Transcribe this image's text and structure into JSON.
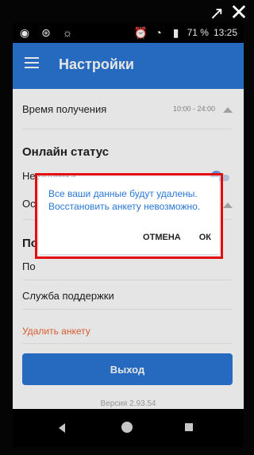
{
  "statusbar": {
    "battery_text": "71 %",
    "time": "13:25"
  },
  "appbar": {
    "title": "Настройки"
  },
  "settings": {
    "receive_time_label": "Время получения",
    "receive_time_value": "10:00 - 24:00",
    "online_status_heading": "Онлайн статус",
    "invisible_label": "Невидимка",
    "partial_1": "Ос",
    "partial_2": "По",
    "partial_3": "По",
    "support_label": "Служба поддержки",
    "delete_profile_label": "Удалить анкету",
    "logout_label": "Выход",
    "version": "Версия 2.93.54"
  },
  "dialog": {
    "message": "Все ваши данные будут удалены. Восстановить анкету невозможно.",
    "cancel_label": "ОТМЕНА",
    "ok_label": "ОК"
  },
  "colors": {
    "accent": "#2a77d4",
    "danger_text": "#f06838",
    "highlight": "#e30d0d"
  },
  "icons": {
    "open_external": "open-external-icon",
    "close": "close-icon",
    "eye": "eye-icon",
    "remote": "remote-control-icon",
    "lightbulb": "lightbulb-icon",
    "alarm": "alarm-icon",
    "battery": "battery-icon",
    "wifi": "wifi-icon",
    "hamburger": "hamburger-menu-icon",
    "nav_back": "back-icon",
    "nav_home": "home-icon",
    "nav_recents": "recents-icon"
  }
}
